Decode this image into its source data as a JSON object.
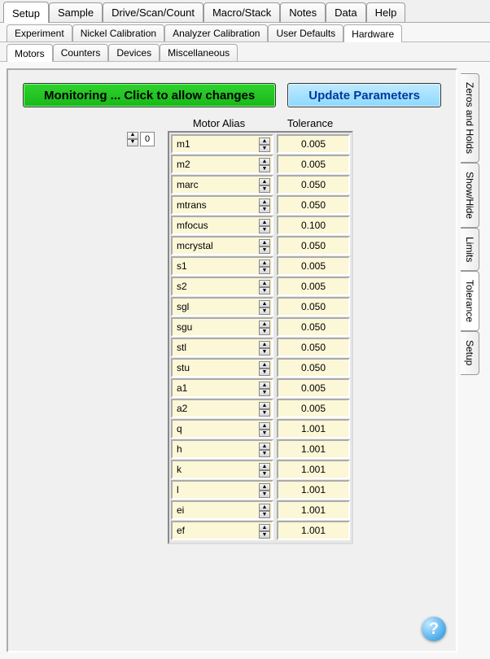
{
  "primary_tabs": [
    "Setup",
    "Sample",
    "Drive/Scan/Count",
    "Macro/Stack",
    "Notes",
    "Data",
    "Help"
  ],
  "primary_active": 0,
  "secondary_tabs": [
    "Experiment",
    "Nickel Calibration",
    "Analyzer Calibration",
    "User Defaults",
    "Hardware"
  ],
  "secondary_active": 4,
  "tertiary_tabs": [
    "Motors",
    "Counters",
    "Devices",
    "Miscellaneous"
  ],
  "tertiary_active": 0,
  "side_tabs": [
    "Zeros and Holds",
    "Show/Hide",
    "Limits",
    "Tolerance",
    "Setup"
  ],
  "side_active": 3,
  "buttons": {
    "monitor": "Monitoring ... Click to allow changes",
    "update": "Update Parameters"
  },
  "grid_headers": {
    "alias": "Motor Alias",
    "tol": "Tolerance"
  },
  "spinner_value": "0",
  "rows": [
    {
      "alias": "m1",
      "tol": "0.005"
    },
    {
      "alias": "m2",
      "tol": "0.005"
    },
    {
      "alias": "marc",
      "tol": "0.050"
    },
    {
      "alias": "mtrans",
      "tol": "0.050"
    },
    {
      "alias": "mfocus",
      "tol": "0.100"
    },
    {
      "alias": "mcrystal",
      "tol": "0.050"
    },
    {
      "alias": "s1",
      "tol": "0.005"
    },
    {
      "alias": "s2",
      "tol": "0.005"
    },
    {
      "alias": "sgl",
      "tol": "0.050"
    },
    {
      "alias": "sgu",
      "tol": "0.050"
    },
    {
      "alias": "stl",
      "tol": "0.050"
    },
    {
      "alias": "stu",
      "tol": "0.050"
    },
    {
      "alias": "a1",
      "tol": "0.005"
    },
    {
      "alias": "a2",
      "tol": "0.005"
    },
    {
      "alias": "q",
      "tol": "1.001"
    },
    {
      "alias": "h",
      "tol": "1.001"
    },
    {
      "alias": "k",
      "tol": "1.001"
    },
    {
      "alias": "l",
      "tol": "1.001"
    },
    {
      "alias": "ei",
      "tol": "1.001"
    },
    {
      "alias": "ef",
      "tol": "1.001"
    }
  ],
  "help": "?"
}
